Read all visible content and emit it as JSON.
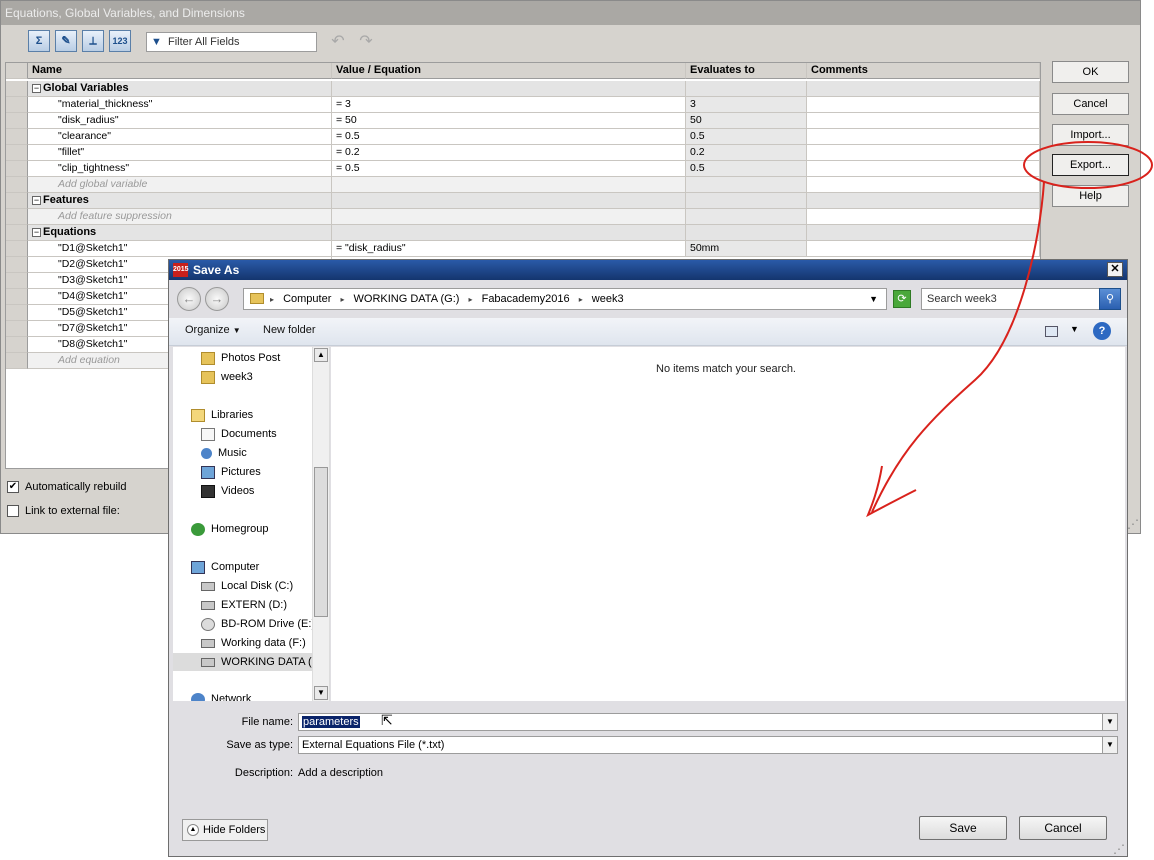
{
  "eq_dialog": {
    "title": "Equations, Global Variables, and Dimensions",
    "toolbar": {
      "filter_placeholder": "Filter All Fields",
      "btn_equation_view": "Σ",
      "btn_sketch_view": "✎",
      "btn_dimension_view": "⟂",
      "btn_ordered_view": "123"
    },
    "columns": [
      "Name",
      "Value / Equation",
      "Evaluates to",
      "Comments"
    ],
    "groups": {
      "global": "Global Variables",
      "features": "Features",
      "equations": "Equations"
    },
    "global_rows": [
      {
        "name": "\"material_thickness\"",
        "value": "= 3",
        "eval": "3"
      },
      {
        "name": "\"disk_radius\"",
        "value": "= 50",
        "eval": "50"
      },
      {
        "name": "\"clearance\"",
        "value": "= 0.5",
        "eval": "0.5"
      },
      {
        "name": "\"fillet\"",
        "value": "= 0.2",
        "eval": "0.2"
      },
      {
        "name": "\"clip_tightness\"",
        "value": "= 0.5",
        "eval": "0.5"
      }
    ],
    "add_global": "Add global variable",
    "add_feature": "Add feature suppression",
    "equation_rows": [
      {
        "name": "\"D1@Sketch1\"",
        "value": "= \"disk_radius\"",
        "eval": "50mm"
      },
      {
        "name": "\"D2@Sketch1\"",
        "value": "",
        "eval": ""
      },
      {
        "name": "\"D3@Sketch1\"",
        "value": "",
        "eval": ""
      },
      {
        "name": "\"D4@Sketch1\"",
        "value": "",
        "eval": ""
      },
      {
        "name": "\"D5@Sketch1\"",
        "value": "",
        "eval": ""
      },
      {
        "name": "\"D7@Sketch1\"",
        "value": "",
        "eval": ""
      },
      {
        "name": "\"D8@Sketch1\"",
        "value": "",
        "eval": ""
      }
    ],
    "add_equation": "Add equation",
    "buttons": {
      "ok": "OK",
      "cancel": "Cancel",
      "import": "Import...",
      "export": "Export...",
      "help": "Help"
    },
    "auto_rebuild_label": "Automatically rebuild",
    "auto_rebuild_check": "✔",
    "link_external_label": "Link to external file:"
  },
  "save_dialog": {
    "title": "Save As",
    "app_icon_text": "2015",
    "breadcrumb": [
      "Computer",
      "WORKING DATA (G:)",
      "Fabacademy2016",
      "week3"
    ],
    "search_placeholder": "Search week3",
    "organize": "Organize",
    "new_folder": "New folder",
    "nav_items": [
      {
        "label": "Photos Post",
        "icon": "folder-icon"
      },
      {
        "label": "week3",
        "icon": "folder-icon"
      },
      {
        "label": "Libraries",
        "icon": "libraries-icon"
      },
      {
        "label": "Documents",
        "icon": "documents-icon"
      },
      {
        "label": "Music",
        "icon": "music-icon"
      },
      {
        "label": "Pictures",
        "icon": "pictures-icon"
      },
      {
        "label": "Videos",
        "icon": "videos-icon"
      },
      {
        "label": "Homegroup",
        "icon": "homegroup-icon"
      },
      {
        "label": "Computer",
        "icon": "computer-icon"
      },
      {
        "label": "Local Disk (C:)",
        "icon": "disk-icon"
      },
      {
        "label": "EXTERN (D:)",
        "icon": "disk-icon"
      },
      {
        "label": "BD-ROM Drive (E:)",
        "icon": "cd-icon"
      },
      {
        "label": "Working data (F:)",
        "icon": "disk-icon"
      },
      {
        "label": "WORKING DATA (G:)",
        "icon": "disk-icon"
      },
      {
        "label": "Network",
        "icon": "network-icon"
      }
    ],
    "empty_message": "No items match your search.",
    "file_name_label": "File name:",
    "file_name_value": "parameters",
    "save_type_label": "Save as type:",
    "save_type_value": "External Equations File (*.txt)",
    "description_label": "Description:",
    "description_value": "Add a description",
    "hide_folders": "Hide Folders",
    "save_button": "Save",
    "cancel_button": "Cancel",
    "close_glyph": "✕"
  },
  "colors": {
    "annotation": "#d9221c",
    "title_active": "#1a4590",
    "dialog_bg": "#d6d3ce"
  }
}
